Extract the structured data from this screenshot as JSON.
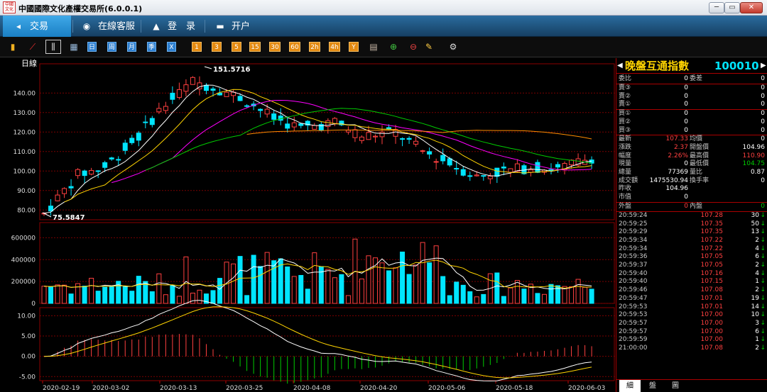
{
  "window": {
    "title": "中國國際文化產權交易所(6.0.0.1)",
    "logo_text": "中國文化",
    "min_label": "─",
    "max_label": "▭",
    "close_label": "✕"
  },
  "nav": {
    "items": [
      {
        "label": "交易",
        "icon": "arrow-icon",
        "glyph": "◂"
      },
      {
        "label": "在線客服",
        "icon": "eye-icon",
        "glyph": "◉"
      },
      {
        "label": "登　录",
        "icon": "user-icon",
        "glyph": "▲"
      },
      {
        "label": "开户",
        "icon": "monitor-icon",
        "glyph": "▬"
      }
    ]
  },
  "toolbar": {
    "icons": [
      "bar-chart-icon",
      "line-chart-icon",
      "candlestick-icon"
    ],
    "periods": [
      "日",
      "周",
      "月",
      "季",
      "X"
    ],
    "minutes": [
      "1",
      "3",
      "5",
      "15",
      "30",
      "60",
      "2h",
      "4h",
      "Y"
    ]
  },
  "chart": {
    "period_label": "日線",
    "high_label": "151.5716",
    "low_label": "75.5847",
    "price_ticks": [
      "140.00",
      "130.00",
      "120.00",
      "110.00",
      "100.00",
      "90.00",
      "80.00"
    ],
    "volume_ticks": [
      "600000",
      "400000",
      "200000",
      "0"
    ],
    "macd_ticks": [
      "10.00",
      "5.00",
      "0.00",
      "-5.00"
    ],
    "date_ticks": [
      "2020-02-19",
      "2020-03-02",
      "2020-03-13",
      "2020-03-25",
      "2020-04-08",
      "2020-04-20",
      "2020-05-06",
      "2020-05-18",
      "2020-06-03"
    ],
    "colors": {
      "up": "#ff4040",
      "down": "#00e5ff",
      "ma5": "#ffffff",
      "ma10": "#ffd400",
      "ma20": "#ff00ff",
      "ma30": "#00cc00",
      "ma60": "#ff8c00",
      "grid": "#7a0000"
    }
  },
  "chart_data": {
    "type": "candlestick",
    "price_ylim": [
      75,
      155
    ],
    "volume_ylim": [
      0,
      700000
    ],
    "macd_ylim": [
      -6,
      12
    ],
    "grid": true
  },
  "quote": {
    "name": "晚盤互通指數",
    "code": "100010",
    "ratio_label": "委比",
    "ratio_value": "0",
    "diff_label": "委差",
    "diff_value": "0",
    "sells": [
      {
        "label": "賣③",
        "price": "0",
        "qty": "0"
      },
      {
        "label": "賣②",
        "price": "0",
        "qty": "0"
      },
      {
        "label": "賣①",
        "price": "0",
        "qty": "0"
      }
    ],
    "buys": [
      {
        "label": "買①",
        "price": "0",
        "qty": "0"
      },
      {
        "label": "買②",
        "price": "0",
        "qty": "0"
      },
      {
        "label": "買③",
        "price": "0",
        "qty": "0"
      }
    ],
    "stats": [
      {
        "l": "最新",
        "v": "107.33",
        "vc": "#ff4040",
        "l2": "均價",
        "v2": "0",
        "v2c": "#ffffff"
      },
      {
        "l": "漲跌",
        "v": "2.37",
        "vc": "#ff4040",
        "l2": "開盤價",
        "v2": "104.96",
        "v2c": "#ffffff"
      },
      {
        "l": "幅度",
        "v": "2.26%",
        "vc": "#ff4040",
        "l2": "最高價",
        "v2": "110.90",
        "v2c": "#ff4040"
      },
      {
        "l": "現量",
        "v": "0",
        "vc": "#ffffff",
        "l2": "最低價",
        "v2": "104.75",
        "v2c": "#00cc00"
      },
      {
        "l": "總量",
        "v": "77369",
        "vc": "#ffffff",
        "l2": "量比",
        "v2": "0.87",
        "v2c": "#ffffff"
      },
      {
        "l": "成交額",
        "v": "1475530.94",
        "vc": "#ffffff",
        "l2": "換手率",
        "v2": "0",
        "v2c": "#ffffff"
      },
      {
        "l": "昨收",
        "v": "104.96",
        "vc": "#ffffff",
        "l2": "",
        "v2": "",
        "v2c": "#ffffff"
      },
      {
        "l": "市值",
        "v": "0",
        "vc": "#ffffff",
        "l2": "",
        "v2": "",
        "v2c": "#ffffff"
      }
    ],
    "outer_label": "外盤",
    "outer_value": "0",
    "inner_label": "內盤",
    "inner_value": "0",
    "ticks": [
      {
        "t": "20:59:24",
        "p": "107.28",
        "q": "30"
      },
      {
        "t": "20:59:25",
        "p": "107.35",
        "q": "50"
      },
      {
        "t": "20:59:29",
        "p": "107.35",
        "q": "13"
      },
      {
        "t": "20:59:34",
        "p": "107.22",
        "q": "2"
      },
      {
        "t": "20:59:34",
        "p": "107.22",
        "q": "4"
      },
      {
        "t": "20:59:36",
        "p": "107.05",
        "q": "6"
      },
      {
        "t": "20:59:37",
        "p": "107.05",
        "q": "2"
      },
      {
        "t": "20:59:40",
        "p": "107.16",
        "q": "4"
      },
      {
        "t": "20:59:40",
        "p": "107.15",
        "q": "1"
      },
      {
        "t": "20:59:46",
        "p": "107.08",
        "q": "2"
      },
      {
        "t": "20:59:47",
        "p": "107.01",
        "q": "19"
      },
      {
        "t": "20:59:53",
        "p": "107.01",
        "q": "14"
      },
      {
        "t": "20:59:53",
        "p": "107.00",
        "q": "10"
      },
      {
        "t": "20:59:57",
        "p": "107.00",
        "q": "3"
      },
      {
        "t": "20:59:57",
        "p": "107.00",
        "q": "6"
      },
      {
        "t": "20:59:59",
        "p": "107.00",
        "q": "1"
      },
      {
        "t": "21:00:00",
        "p": "107.08",
        "q": "2"
      }
    ],
    "tabs": [
      "細",
      "盤",
      "圖"
    ]
  }
}
